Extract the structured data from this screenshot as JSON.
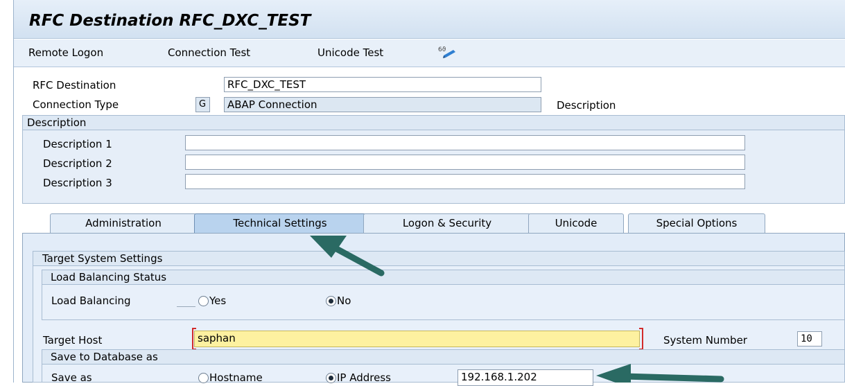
{
  "title": "RFC Destination RFC_DXC_TEST",
  "menu": {
    "items": [
      "Remote Logon",
      "Connection Test",
      "Unicode Test"
    ],
    "glasses_icon": "glasses-icon"
  },
  "header": {
    "rfc_destination_label": "RFC Destination",
    "rfc_destination_value": "RFC_DXC_TEST",
    "connection_type_label": "Connection Type",
    "connection_type_code": "G",
    "connection_type_value": "ABAP Connection",
    "description_right": "Description"
  },
  "description_group": {
    "title": "Description",
    "rows": [
      {
        "label": "Description 1",
        "value": ""
      },
      {
        "label": "Description 2",
        "value": ""
      },
      {
        "label": "Description 3",
        "value": ""
      }
    ]
  },
  "tabs": [
    {
      "label": "Administration",
      "active": false
    },
    {
      "label": "Technical Settings",
      "active": true
    },
    {
      "label": "Logon & Security",
      "active": false
    },
    {
      "label": "Unicode",
      "active": false
    },
    {
      "label": "Special Options",
      "active": false
    }
  ],
  "target_system": {
    "title": "Target System Settings",
    "load_balancing_status": {
      "title": "Load Balancing Status",
      "label": "Load Balancing",
      "options": [
        {
          "label": "Yes",
          "selected": false
        },
        {
          "label": "No",
          "selected": true
        }
      ]
    },
    "target_host_label": "Target Host",
    "target_host_value": "saphan",
    "system_number_label": "System Number",
    "system_number_value": "10",
    "save_db": {
      "title": "Save to Database as",
      "label": "Save as",
      "options": [
        {
          "label": "Hostname",
          "selected": false
        },
        {
          "label": "IP Address",
          "selected": true
        }
      ],
      "ip_value": "192.168.1.202"
    }
  },
  "colors": {
    "title_bar": "#dce8f5",
    "panel": "#dfeaf6",
    "arrow": "#2a6a63",
    "required_marker": "#d22b2b",
    "highlight_field": "#fdf1a0"
  }
}
